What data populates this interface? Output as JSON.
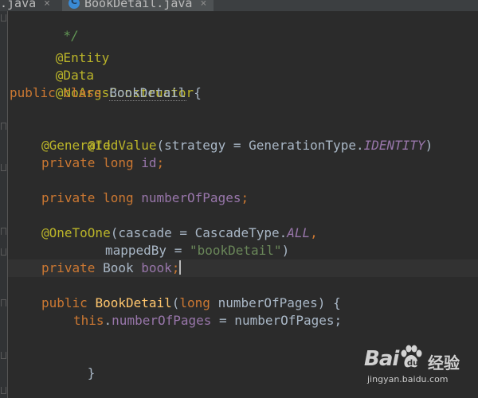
{
  "tabs": [
    {
      "label": ".java",
      "active": false,
      "close": "×"
    },
    {
      "label": "BookDetail.java",
      "active": true,
      "close": "×"
    }
  ],
  "code": {
    "l1_comment": " */",
    "l2_ann": "@Entity",
    "l3_ann": "@Data",
    "l4_ann": "@NoArgsConstructor",
    "l5_kw": "public class ",
    "l5_cls": "BookDetail",
    "l5_rest": " {",
    "l6_ann": "@Id",
    "l7_ann": "@GeneratedValue",
    "l7_a": "(strategy = GenerationType.",
    "l7_const": "IDENTITY",
    "l7_b": ")",
    "l8_kw": "private long ",
    "l8_fld": "id",
    "l8_end": ";",
    "l9_kw": "private long ",
    "l9_fld": "numberOfPages",
    "l9_end": ";",
    "l10_ann": "@OneToOne",
    "l10_a": "(cascade = CascadeType.",
    "l10_const": "ALL",
    "l10_end": ",",
    "l11_a": "mappedBy = ",
    "l11_str": "\"bookDetail\"",
    "l11_b": ")",
    "l12_kw": "private ",
    "l12_type": "Book ",
    "l12_fld": "book",
    "l12_end": ";",
    "l13_kw": "public ",
    "l13_method": "BookDetail",
    "l13_a": "(",
    "l13_kw2": "long ",
    "l13_b": "numberOfPages) {",
    "l14_kw": "this",
    "l14_dot": ".",
    "l14_fld": "numberOfPages",
    "l14_rest": " = numberOfPages;",
    "l15_close": "}",
    "l16_close": "}"
  },
  "watermark": {
    "brand": "Bai",
    "paw_icon": "baidu-paw-icon",
    "cn": "经验",
    "url": "jingyan.baidu.com"
  },
  "colors": {
    "background": "#2b2b2b",
    "keyword": "#cc7832",
    "annotation": "#bbb529",
    "string": "#6a8759",
    "field": "#9876aa",
    "method": "#ffc66d",
    "text": "#a9b7c6",
    "comment": "#629755"
  }
}
